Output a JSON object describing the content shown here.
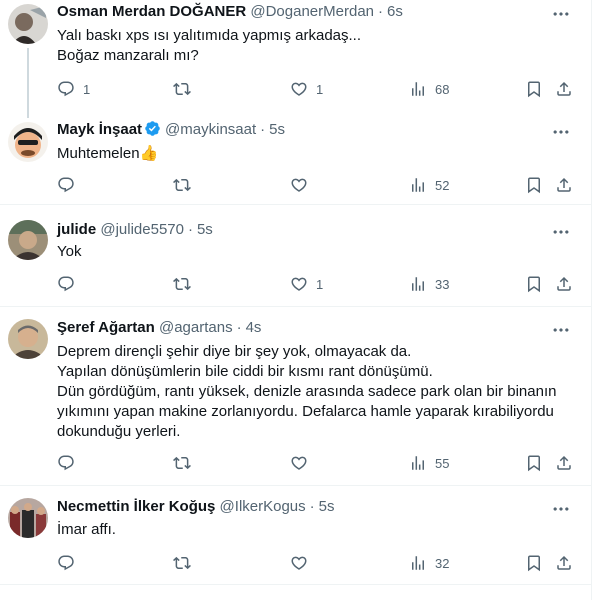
{
  "tweets": [
    {
      "name": "Osman Merdan DOĞANER",
      "handle": "@DoganerMerdan",
      "time": "6s",
      "text": "Yalı baskı xps ısı yalıtımıda yapmış arkadaş...\nBoğaz manzaralı mı?",
      "replies": "1",
      "retweets": "",
      "likes": "1",
      "views": "68"
    },
    {
      "name": "Mayk İnşaat",
      "handle": "@maykinsaat",
      "time": "5s",
      "text": "Muhtemelen👍",
      "replies": "",
      "retweets": "",
      "likes": "",
      "views": "52"
    },
    {
      "name": "julide",
      "handle": "@julide5570",
      "time": "5s",
      "text": "Yok",
      "replies": "",
      "retweets": "",
      "likes": "1",
      "views": "33"
    },
    {
      "name": "Şeref Ağartan",
      "handle": "@agartans",
      "time": "4s",
      "text": "Deprem dirençli şehir diye bir şey yok, olmayacak da.\nYapılan dönüşümlerin bile ciddi bir kısmı rant dönüşümü.\nDün gördüğüm, rantı yüksek, denizle arasında sadece park olan bir binanın yıkımını yapan makine zorlanıyordu. Defalarca hamle yaparak kırabiliyordu dokunduğu yerleri.",
      "replies": "",
      "retweets": "",
      "likes": "",
      "views": "55"
    },
    {
      "name": "Necmettin İlker Koğuş",
      "handle": "@IlkerKogus",
      "time": "5s",
      "text": "İmar affı.",
      "replies": "",
      "retweets": "",
      "likes": "",
      "views": "32"
    }
  ],
  "colors": {
    "text": "#0f1419",
    "secondary": "#536471",
    "verified": "#1d9bf0",
    "border": "#eff3f4",
    "thread_line": "#cfd9de"
  },
  "icons": [
    "more-icon",
    "reply-icon",
    "retweet-icon",
    "like-icon",
    "views-icon",
    "bookmark-icon",
    "share-icon",
    "verified-badge-icon"
  ]
}
